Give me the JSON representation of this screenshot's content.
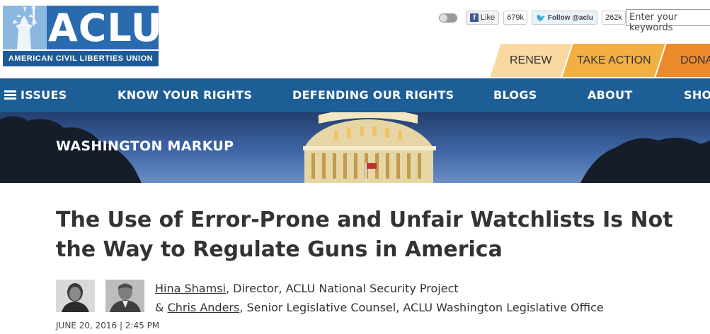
{
  "logo": {
    "main_text": "ACLU",
    "subtitle": "AMERICAN CIVIL LIBERTIES UNION"
  },
  "social": {
    "like_label": "Like",
    "like_count": "679k",
    "follow_label": "Follow @aclu",
    "follow_count": "262k"
  },
  "search": {
    "placeholder": "Enter your keywords"
  },
  "actions": {
    "renew": "RENEW",
    "take_action": "TAKE ACTION",
    "donate": "DONATE"
  },
  "nav": {
    "issues": "ISSUES",
    "know_your_rights": "KNOW YOUR RIGHTS",
    "defending_our_rights": "DEFENDING OUR RIGHTS",
    "blogs": "BLOGS",
    "about": "ABOUT",
    "shop": "SHOP"
  },
  "banner": {
    "title": "WASHINGTON MARKUP"
  },
  "article": {
    "headline": "The Use of Error-Prone and Unfair Watchlists Is Not the Way to Regulate Guns in America",
    "author1_name": "Hina Shamsi",
    "author1_role": ", Director, ACLU National Security Project",
    "author2_prefix": "& ",
    "author2_name": "Chris Anders",
    "author2_role": ", Senior Legislative Counsel, ACLU Washington Legislative Office",
    "date": "JUNE 20, 2016 | 2:45 PM"
  },
  "colors": {
    "nav_blue": "#1d5e96",
    "logo_blue": "#2a6bb0",
    "renew": "#f9d8a2",
    "take_action": "#f2b043",
    "donate": "#ee8a2e"
  }
}
